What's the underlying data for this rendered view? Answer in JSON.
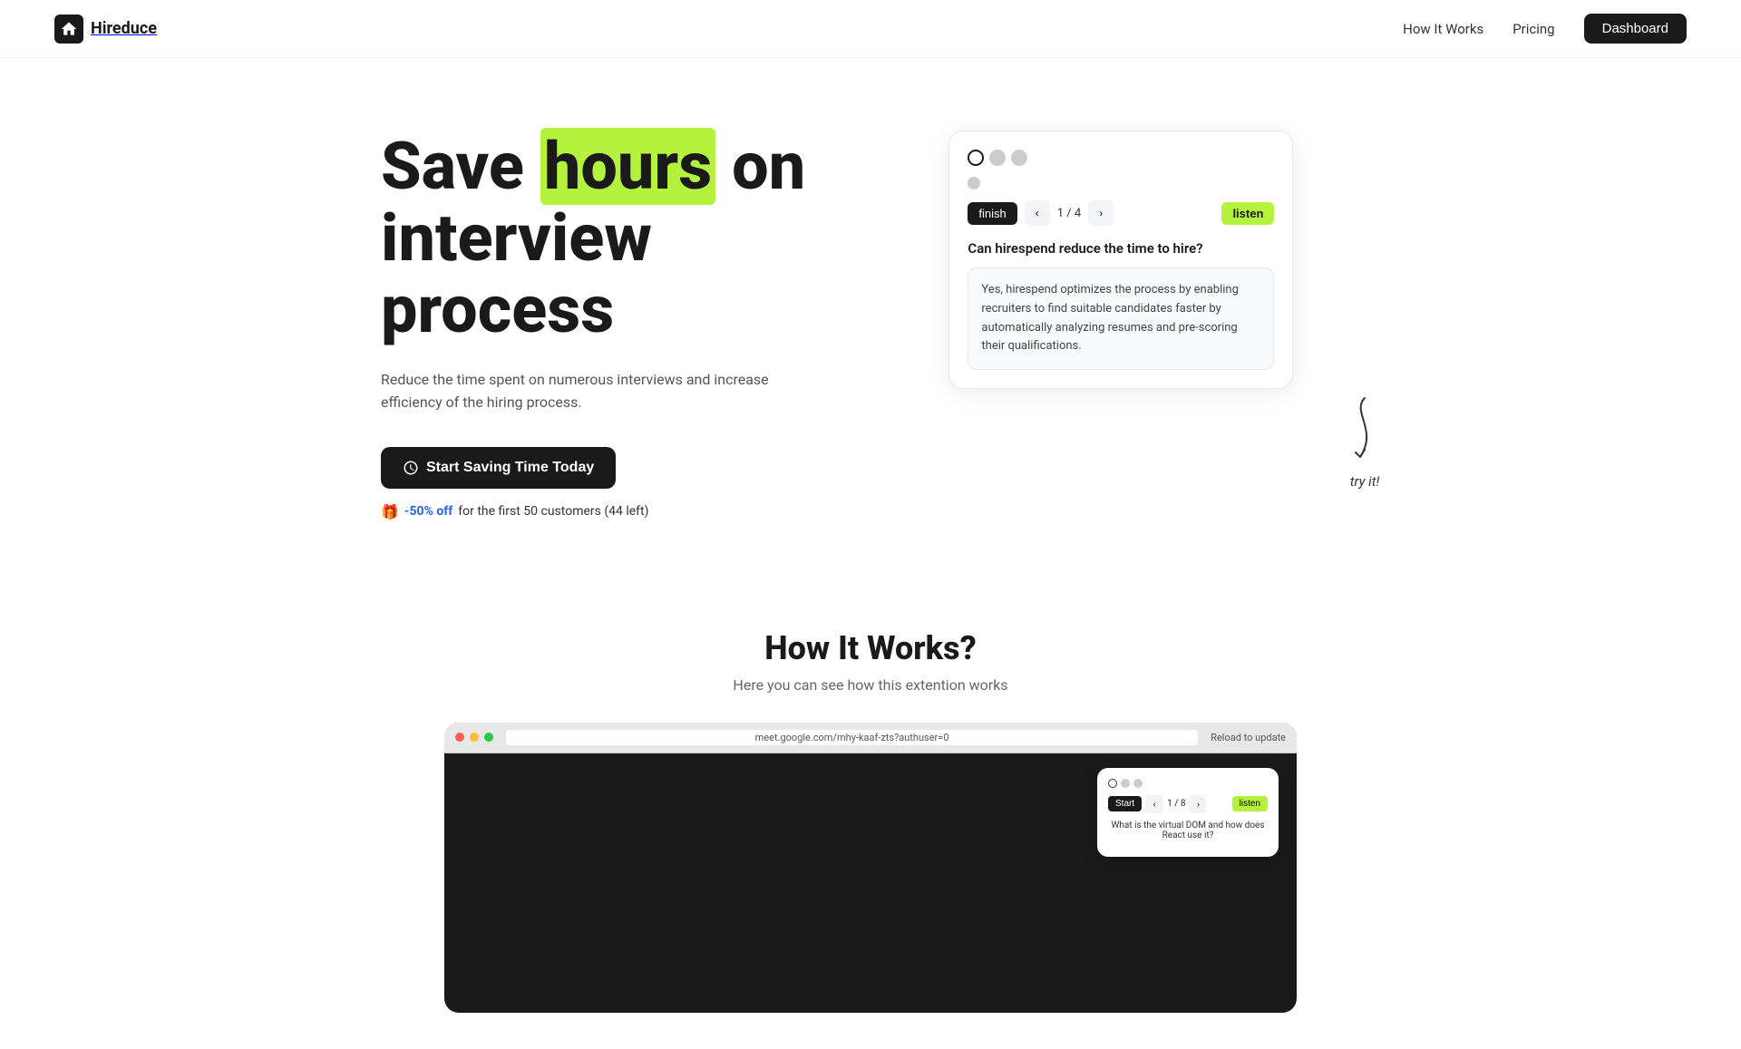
{
  "nav": {
    "logo_text": "Hireduce",
    "links": [
      {
        "id": "how-it-works",
        "label": "How It Works"
      },
      {
        "id": "pricing",
        "label": "Pricing"
      }
    ],
    "dashboard_label": "Dashboard"
  },
  "hero": {
    "title_pre": "Save ",
    "title_highlight": "hours",
    "title_post": " on interview process",
    "subtitle": "Reduce the time spent on numerous interviews and increase efficiency of the hiring process.",
    "cta_label": "Start Saving Time Today",
    "promo_text": "-50% off",
    "promo_suffix": "for the first 50 customers (44 left)"
  },
  "widget": {
    "finish_label": "finish",
    "page_indicator": "1 / 4",
    "listen_label": "listen",
    "question": "Can hirespend reduce the time to hire?",
    "answer": "Yes, hirespend optimizes the process by enabling recruiters to find suitable candidates faster by automatically analyzing resumes and pre-scoring their qualifications.",
    "try_it_label": "try it!"
  },
  "how_section": {
    "title": "How It Works?",
    "subtitle": "Here you can see how this extention works"
  },
  "video": {
    "url": "meet.google.com/mhy-kaaf-zts?authuser=0",
    "inner_widget": {
      "page": "1 / 8",
      "start_label": "Start",
      "listen_label": "listen",
      "question": "What is the virtual DOM and how does React use it?"
    }
  }
}
